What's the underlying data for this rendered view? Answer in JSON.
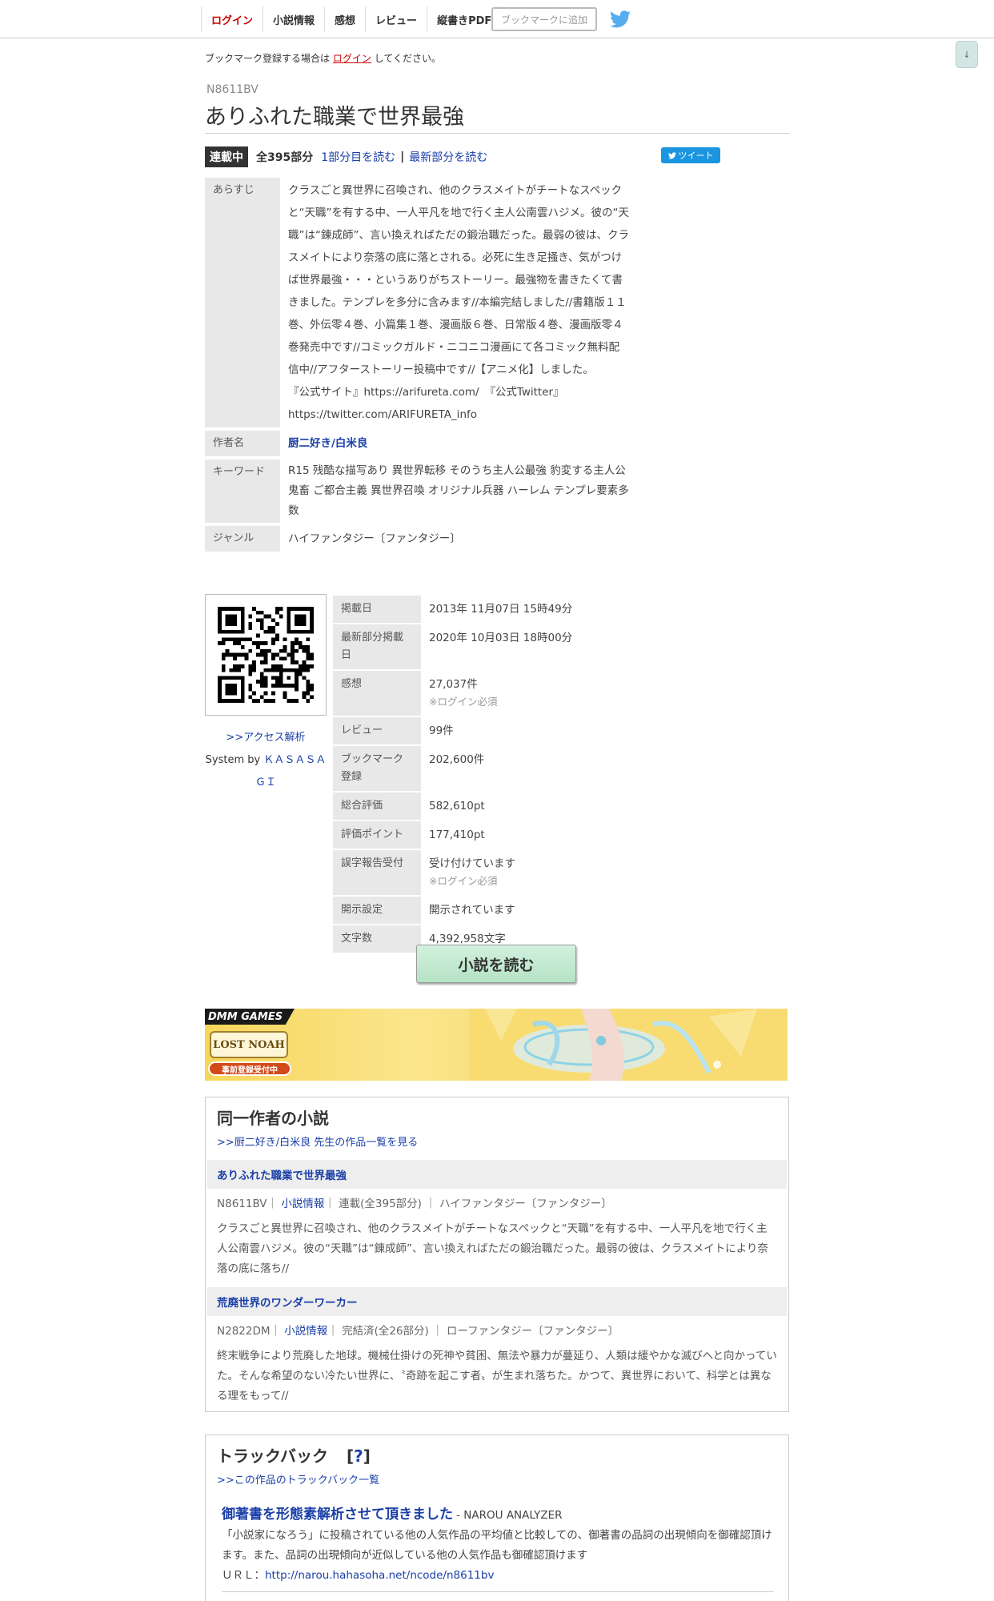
{
  "nav": {
    "items": [
      "ログイン",
      "小説情報",
      "感想",
      "レビュー",
      "縦書きPDF"
    ],
    "bookmark_button": "ブックマークに追加"
  },
  "scroll_button": "↓",
  "notice": {
    "before": "ブックマーク登録する場合は",
    "link": "ログイン",
    "after": "してください。"
  },
  "novel": {
    "ncode": "N8611BV",
    "title": "ありふれた職業で世界最強",
    "status": "連載中",
    "parts": "全395部分",
    "read_first": "1部分目を読む",
    "separator": "|",
    "read_latest": "最新部分を読む",
    "tweet": "ツイート"
  },
  "info": {
    "synopsis_label": "あらすじ",
    "synopsis": "クラスごと異世界に召喚され、他のクラスメイトがチートなスペックと“天職”を有する中、一人平凡を地で行く主人公南雲ハジメ。彼の“天職”は“錬成師”、言い換えればただの鍛治職だった。最弱の彼は、クラスメイトにより奈落の底に落とされる。必死に生き足掻き、気がつけば世界最強・・・というありがちストーリー。最強物を書きたくて書きました。テンプレを多分に含みます//本編完結しました//書籍版１１巻、外伝零４巻、小篇集１巻、漫画版６巻、日常版４巻、漫画版零４巻発売中です//コミックガルド・ニコニコ漫画にて各コミック無料配信中//アフターストーリー投稿中です//【アニメ化】しました。",
    "synopsis_links": "『公式サイト』https://arifureta.com/　『公式Twitter』https://twitter.com/ARIFURETA_info",
    "author_label": "作者名",
    "author": "厨二好き/白米良",
    "keyword_label": "キーワード",
    "keywords": "R15 残酷な描写あり 異世界転移 そのうち主人公最強 豹変する主人公 鬼畜 ご都合主義 異世界召喚 オリジナル兵器 ハーレム テンプレ要素多数",
    "genre_label": "ジャンル",
    "genre": "ハイファンタジー〔ファンタジー〕"
  },
  "side": {
    "access": ">>アクセス解析",
    "system_by": "System by",
    "system_name": "ＫＡＳＡＳＡＧＩ"
  },
  "stats": [
    {
      "label": "掲載日",
      "value": "2013年 11月07日 15時49分",
      "note": ""
    },
    {
      "label": "最新部分掲載日",
      "value": "2020年 10月03日 18時00分",
      "note": ""
    },
    {
      "label": "感想",
      "value": "27,037件",
      "note": "※ログイン必須"
    },
    {
      "label": "レビュー",
      "value": "99件",
      "note": ""
    },
    {
      "label": "ブックマーク登録",
      "value": "202,600件",
      "note": ""
    },
    {
      "label": "総合評価",
      "value": "582,610pt",
      "note": ""
    },
    {
      "label": "評価ポイント",
      "value": "177,410pt",
      "note": ""
    },
    {
      "label": "誤字報告受付",
      "value": "受け付けています",
      "note": "※ログイン必須"
    },
    {
      "label": "開示設定",
      "value": "開示されています",
      "note": ""
    },
    {
      "label": "文字数",
      "value": "4,392,958文字",
      "note": ""
    }
  ],
  "read_button": "小説を読む",
  "banner": {
    "brand": "DMM GAMES",
    "game": "LOST NOAH",
    "preregister": "事前登録受付中"
  },
  "same_author": {
    "heading": "同一作者の小説",
    "more": ">>厨二好き/白米良 先生の作品一覧を見る",
    "works": [
      {
        "title": "ありふれた職業で世界最強",
        "ncode": "N8611BV",
        "info_link": "小説情報",
        "status": "連載(全395部分)",
        "genre": "ハイファンタジー〔ファンタジー〕",
        "desc": "クラスごと異世界に召喚され、他のクラスメイトがチートなスペックと“天職”を有する中、一人平凡を地で行く主人公南雲ハジメ。彼の“天職”は“錬成師”、言い換えればただの鍛治職だった。最弱の彼は、クラスメイトにより奈落の底に落ち//"
      },
      {
        "title": "荒廃世界のワンダーワーカー",
        "ncode": "N2822DM",
        "info_link": "小説情報",
        "status": "完結済(全26部分)",
        "genre": "ローファンタジー〔ファンタジー〕",
        "desc": "終末戦争により荒廃した地球。機械仕掛けの死神や貧困、無法や暴力が蔓延り、人類は緩やかな滅びへと向かっていた。そんな希望のない冷たい世界に、〝奇跡を起こす者〟が生まれ落ちた。かつて、異世界において、科学とは異なる理をもって//"
      }
    ]
  },
  "trackback": {
    "heading": "トラックバック",
    "help": "?",
    "list_link": ">>この作品のトラックバック一覧",
    "entry_title": "御著書を形態素解析させて頂きました",
    "entry_source": "- NAROU ANALYZER",
    "entry_desc": "「小説家になろう」に投稿されている他の人気作品の平均値と比較しての、御著書の品詞の出現傾向を御確認頂けます。また、品詞の出現傾向が近似している他の人気作品も御確認頂けます",
    "url_label": "ＵＲＬ：",
    "url": "http://narou.hahasoha.net/ncode/n8611bv"
  }
}
